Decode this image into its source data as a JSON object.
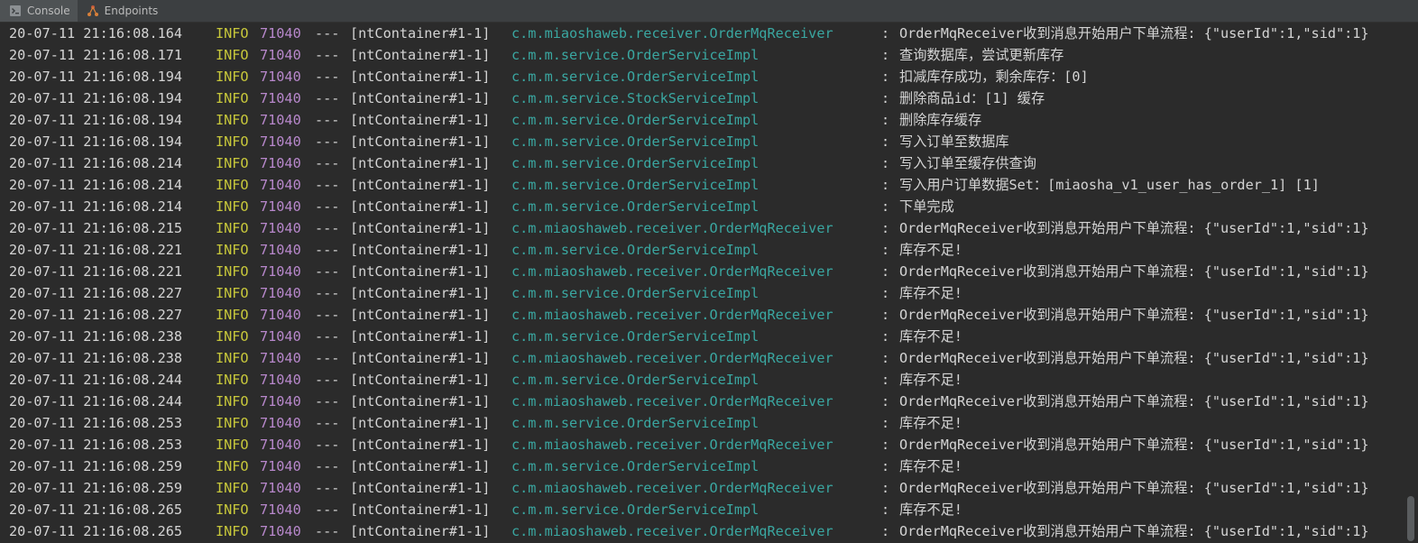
{
  "tabs": [
    {
      "label": "Console",
      "icon": "console-icon",
      "active": true
    },
    {
      "label": "Endpoints",
      "icon": "endpoints-icon",
      "active": false
    }
  ],
  "colors": {
    "timestamp": "#d4d4d4",
    "level": "#c8c83b",
    "pid": "#b888cc",
    "logger": "#3aa7a1",
    "background": "#2b2b2b"
  },
  "log_lines": [
    {
      "ts": "20-07-11 21:16:08.164",
      "level": "INFO",
      "pid": "71040",
      "sep": "---",
      "thread": "[ntContainer#1-1]",
      "logger": "c.m.miaoshaweb.receiver.OrderMqReceiver",
      "colon": ":",
      "msg": "OrderMqReceiver收到消息开始用户下单流程: {\"userId\":1,\"sid\":1}"
    },
    {
      "ts": "20-07-11 21:16:08.171",
      "level": "INFO",
      "pid": "71040",
      "sep": "---",
      "thread": "[ntContainer#1-1]",
      "logger": "c.m.m.service.OrderServiceImpl",
      "colon": ":",
      "msg": "查询数据库，尝试更新库存"
    },
    {
      "ts": "20-07-11 21:16:08.194",
      "level": "INFO",
      "pid": "71040",
      "sep": "---",
      "thread": "[ntContainer#1-1]",
      "logger": "c.m.m.service.OrderServiceImpl",
      "colon": ":",
      "msg": "扣减库存成功，剩余库存：[0]"
    },
    {
      "ts": "20-07-11 21:16:08.194",
      "level": "INFO",
      "pid": "71040",
      "sep": "---",
      "thread": "[ntContainer#1-1]",
      "logger": "c.m.m.service.StockServiceImpl",
      "colon": ":",
      "msg": "删除商品id：[1] 缓存"
    },
    {
      "ts": "20-07-11 21:16:08.194",
      "level": "INFO",
      "pid": "71040",
      "sep": "---",
      "thread": "[ntContainer#1-1]",
      "logger": "c.m.m.service.OrderServiceImpl",
      "colon": ":",
      "msg": "删除库存缓存"
    },
    {
      "ts": "20-07-11 21:16:08.194",
      "level": "INFO",
      "pid": "71040",
      "sep": "---",
      "thread": "[ntContainer#1-1]",
      "logger": "c.m.m.service.OrderServiceImpl",
      "colon": ":",
      "msg": "写入订单至数据库"
    },
    {
      "ts": "20-07-11 21:16:08.214",
      "level": "INFO",
      "pid": "71040",
      "sep": "---",
      "thread": "[ntContainer#1-1]",
      "logger": "c.m.m.service.OrderServiceImpl",
      "colon": ":",
      "msg": "写入订单至缓存供查询"
    },
    {
      "ts": "20-07-11 21:16:08.214",
      "level": "INFO",
      "pid": "71040",
      "sep": "---",
      "thread": "[ntContainer#1-1]",
      "logger": "c.m.m.service.OrderServiceImpl",
      "colon": ":",
      "msg": "写入用户订单数据Set：[miaosha_v1_user_has_order_1] [1]"
    },
    {
      "ts": "20-07-11 21:16:08.214",
      "level": "INFO",
      "pid": "71040",
      "sep": "---",
      "thread": "[ntContainer#1-1]",
      "logger": "c.m.m.service.OrderServiceImpl",
      "colon": ":",
      "msg": "下单完成"
    },
    {
      "ts": "20-07-11 21:16:08.215",
      "level": "INFO",
      "pid": "71040",
      "sep": "---",
      "thread": "[ntContainer#1-1]",
      "logger": "c.m.miaoshaweb.receiver.OrderMqReceiver",
      "colon": ":",
      "msg": "OrderMqReceiver收到消息开始用户下单流程: {\"userId\":1,\"sid\":1}"
    },
    {
      "ts": "20-07-11 21:16:08.221",
      "level": "INFO",
      "pid": "71040",
      "sep": "---",
      "thread": "[ntContainer#1-1]",
      "logger": "c.m.m.service.OrderServiceImpl",
      "colon": ":",
      "msg": "库存不足!"
    },
    {
      "ts": "20-07-11 21:16:08.221",
      "level": "INFO",
      "pid": "71040",
      "sep": "---",
      "thread": "[ntContainer#1-1]",
      "logger": "c.m.miaoshaweb.receiver.OrderMqReceiver",
      "colon": ":",
      "msg": "OrderMqReceiver收到消息开始用户下单流程: {\"userId\":1,\"sid\":1}"
    },
    {
      "ts": "20-07-11 21:16:08.227",
      "level": "INFO",
      "pid": "71040",
      "sep": "---",
      "thread": "[ntContainer#1-1]",
      "logger": "c.m.m.service.OrderServiceImpl",
      "colon": ":",
      "msg": "库存不足!"
    },
    {
      "ts": "20-07-11 21:16:08.227",
      "level": "INFO",
      "pid": "71040",
      "sep": "---",
      "thread": "[ntContainer#1-1]",
      "logger": "c.m.miaoshaweb.receiver.OrderMqReceiver",
      "colon": ":",
      "msg": "OrderMqReceiver收到消息开始用户下单流程: {\"userId\":1,\"sid\":1}"
    },
    {
      "ts": "20-07-11 21:16:08.238",
      "level": "INFO",
      "pid": "71040",
      "sep": "---",
      "thread": "[ntContainer#1-1]",
      "logger": "c.m.m.service.OrderServiceImpl",
      "colon": ":",
      "msg": "库存不足!"
    },
    {
      "ts": "20-07-11 21:16:08.238",
      "level": "INFO",
      "pid": "71040",
      "sep": "---",
      "thread": "[ntContainer#1-1]",
      "logger": "c.m.miaoshaweb.receiver.OrderMqReceiver",
      "colon": ":",
      "msg": "OrderMqReceiver收到消息开始用户下单流程: {\"userId\":1,\"sid\":1}"
    },
    {
      "ts": "20-07-11 21:16:08.244",
      "level": "INFO",
      "pid": "71040",
      "sep": "---",
      "thread": "[ntContainer#1-1]",
      "logger": "c.m.m.service.OrderServiceImpl",
      "colon": ":",
      "msg": "库存不足!"
    },
    {
      "ts": "20-07-11 21:16:08.244",
      "level": "INFO",
      "pid": "71040",
      "sep": "---",
      "thread": "[ntContainer#1-1]",
      "logger": "c.m.miaoshaweb.receiver.OrderMqReceiver",
      "colon": ":",
      "msg": "OrderMqReceiver收到消息开始用户下单流程: {\"userId\":1,\"sid\":1}"
    },
    {
      "ts": "20-07-11 21:16:08.253",
      "level": "INFO",
      "pid": "71040",
      "sep": "---",
      "thread": "[ntContainer#1-1]",
      "logger": "c.m.m.service.OrderServiceImpl",
      "colon": ":",
      "msg": "库存不足!"
    },
    {
      "ts": "20-07-11 21:16:08.253",
      "level": "INFO",
      "pid": "71040",
      "sep": "---",
      "thread": "[ntContainer#1-1]",
      "logger": "c.m.miaoshaweb.receiver.OrderMqReceiver",
      "colon": ":",
      "msg": "OrderMqReceiver收到消息开始用户下单流程: {\"userId\":1,\"sid\":1}"
    },
    {
      "ts": "20-07-11 21:16:08.259",
      "level": "INFO",
      "pid": "71040",
      "sep": "---",
      "thread": "[ntContainer#1-1]",
      "logger": "c.m.m.service.OrderServiceImpl",
      "colon": ":",
      "msg": "库存不足!"
    },
    {
      "ts": "20-07-11 21:16:08.259",
      "level": "INFO",
      "pid": "71040",
      "sep": "---",
      "thread": "[ntContainer#1-1]",
      "logger": "c.m.miaoshaweb.receiver.OrderMqReceiver",
      "colon": ":",
      "msg": "OrderMqReceiver收到消息开始用户下单流程: {\"userId\":1,\"sid\":1}"
    },
    {
      "ts": "20-07-11 21:16:08.265",
      "level": "INFO",
      "pid": "71040",
      "sep": "---",
      "thread": "[ntContainer#1-1]",
      "logger": "c.m.m.service.OrderServiceImpl",
      "colon": ":",
      "msg": "库存不足!"
    },
    {
      "ts": "20-07-11 21:16:08.265",
      "level": "INFO",
      "pid": "71040",
      "sep": "---",
      "thread": "[ntContainer#1-1]",
      "logger": "c.m.miaoshaweb.receiver.OrderMqReceiver",
      "colon": ":",
      "msg": "OrderMqReceiver收到消息开始用户下单流程: {\"userId\":1,\"sid\":1}"
    }
  ]
}
